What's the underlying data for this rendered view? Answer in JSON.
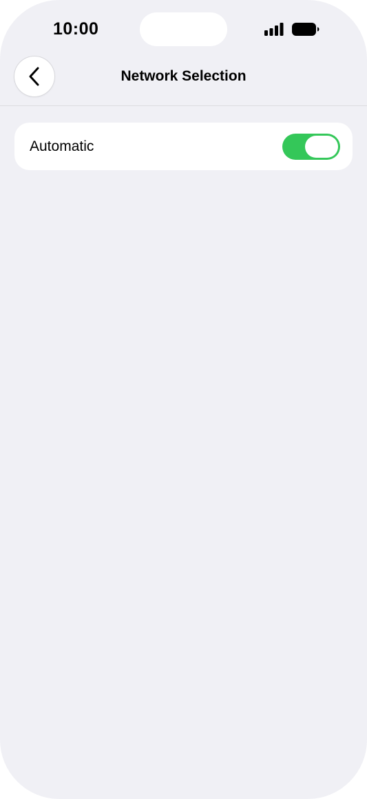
{
  "status_bar": {
    "time": "10:00"
  },
  "header": {
    "title": "Network Selection",
    "back_icon": "chevron-left-icon"
  },
  "settings": {
    "rows": [
      {
        "label": "Automatic",
        "toggle_on": true
      }
    ]
  },
  "colors": {
    "background": "#f0f0f5",
    "toggle_on": "#34c759"
  }
}
